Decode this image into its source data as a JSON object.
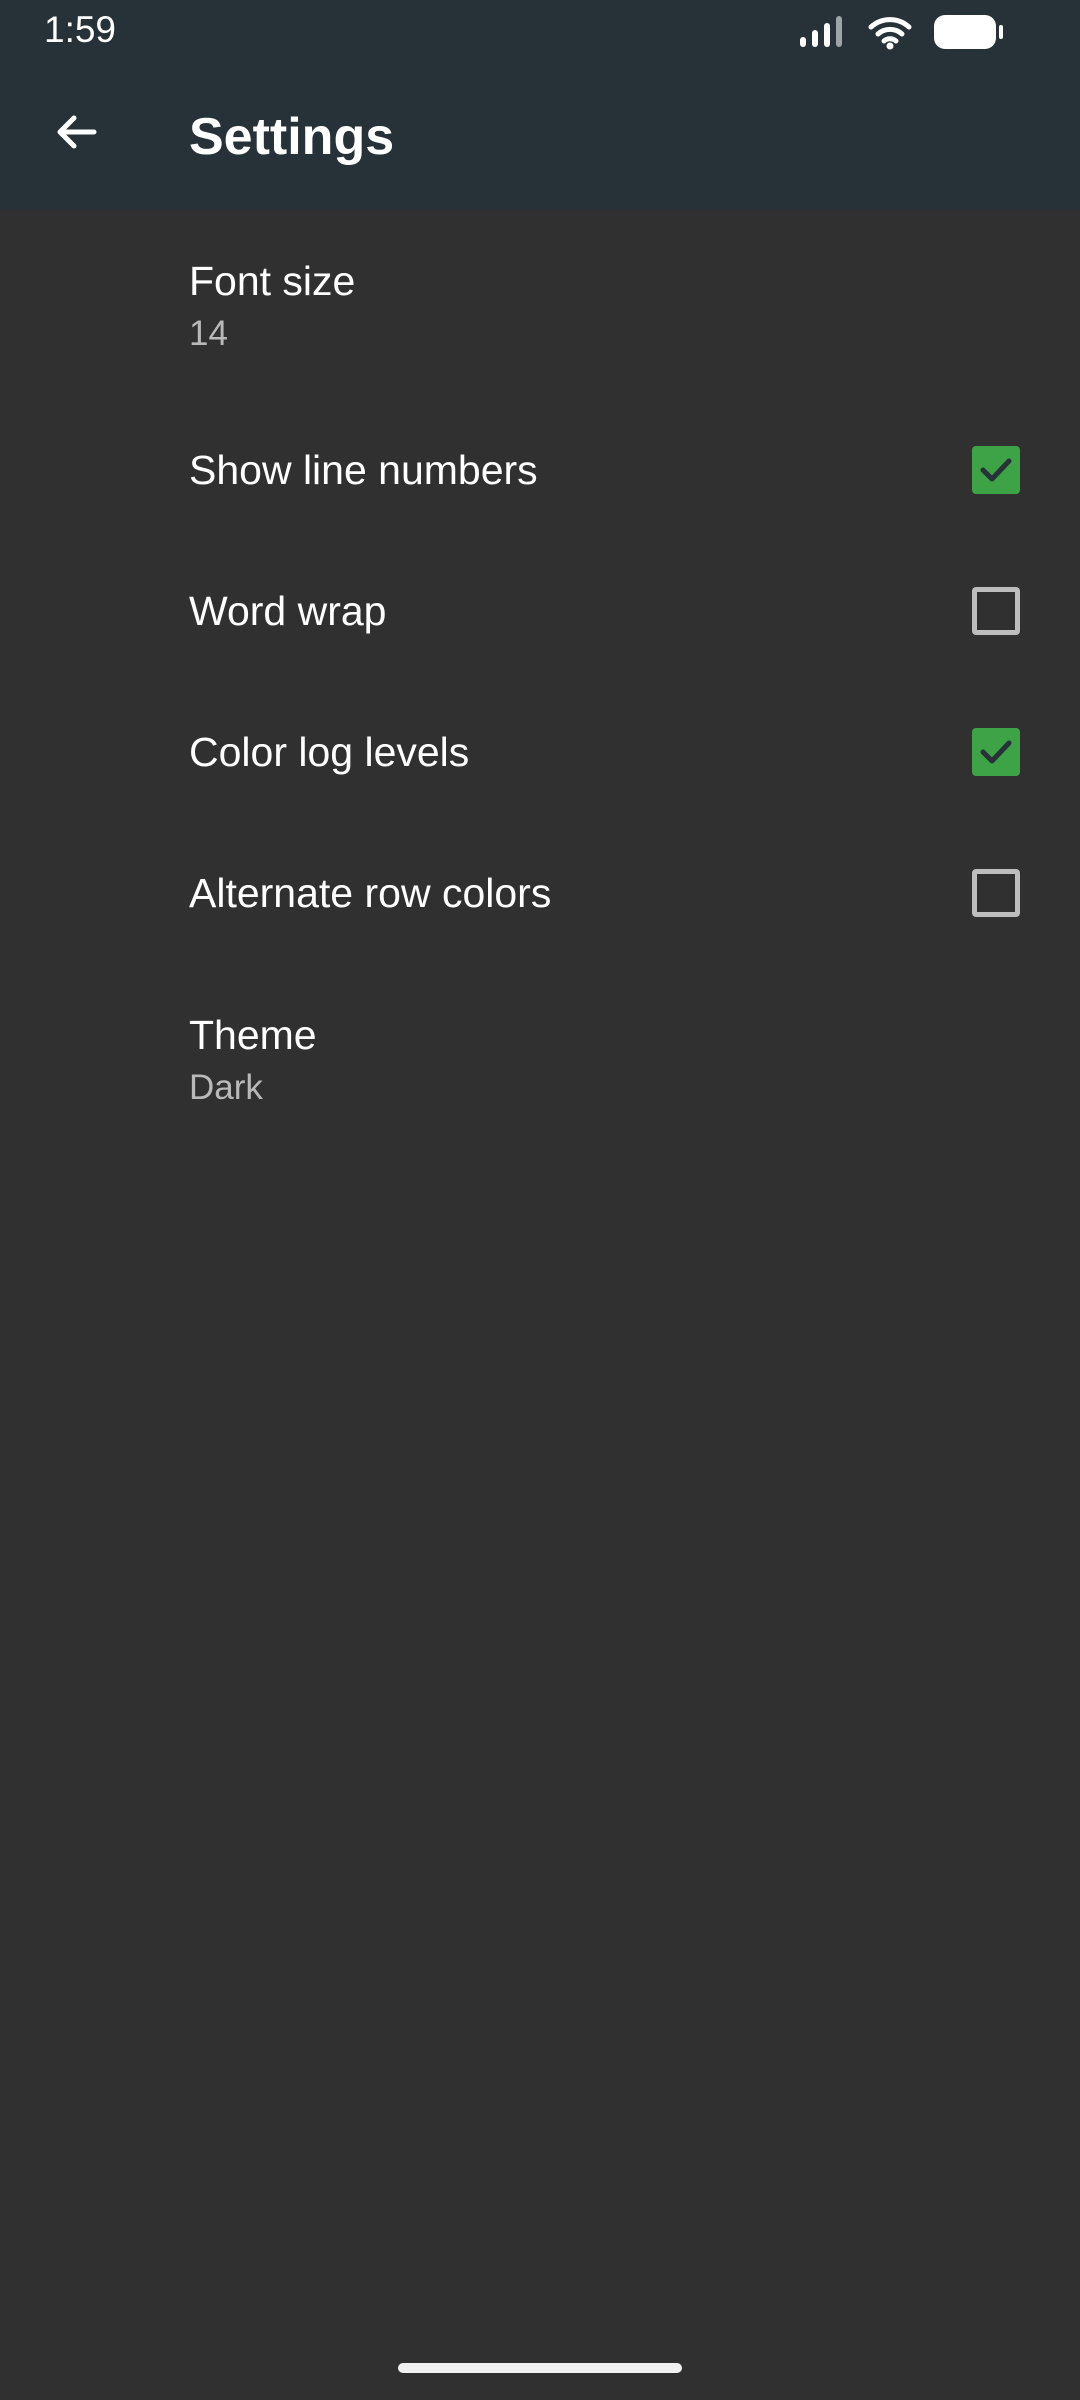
{
  "status_bar": {
    "time": "1:59",
    "icons": [
      "signal-icon",
      "wifi-icon",
      "battery-icon"
    ]
  },
  "toolbar": {
    "back_icon": "arrow-back-icon",
    "title": "Settings"
  },
  "settings": [
    {
      "title": "Font size",
      "summary": "14"
    },
    {
      "title": "Show line numbers",
      "checked": true
    },
    {
      "title": "Word wrap",
      "checked": false
    },
    {
      "title": "Color log levels",
      "checked": true
    },
    {
      "title": "Alternate row colors",
      "checked": false
    },
    {
      "title": "Theme",
      "summary": "Dark"
    }
  ],
  "colors": {
    "toolbar": "#263238",
    "background": "#303030",
    "checkbox_checked": "#3ea346",
    "checkbox_unchecked_border": "#bdbdbd",
    "summary_text": "#b9b9b9"
  }
}
